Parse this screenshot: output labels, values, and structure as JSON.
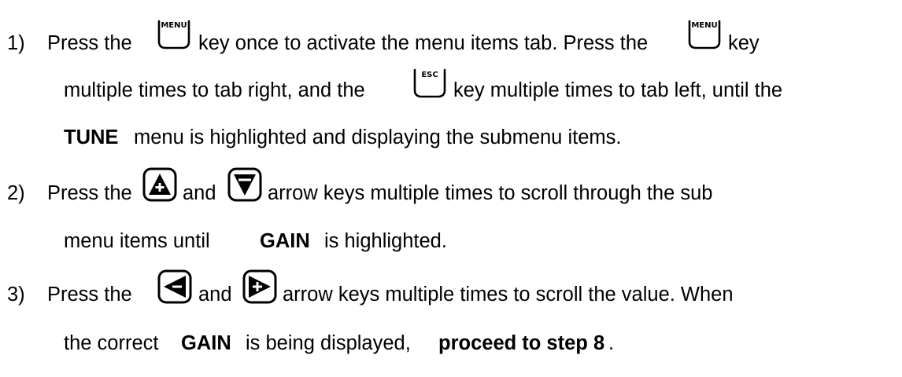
{
  "steps": [
    {
      "number": "1)",
      "line1_part1": "Press the",
      "line1_key1": "MENU",
      "line1_part2": "key once to activate the menu items tab.  Press the",
      "line1_key2": "MENU",
      "line1_part3": "key",
      "line2_part1": "multiple times to tab right, and the",
      "line2_key": "ESC",
      "line2_part2": "key multiple times to tab left, until the",
      "line3_bold": "TUNE",
      "line3_part": "menu is highlighted and displaying the submenu items."
    },
    {
      "number": "2)",
      "line1_part1": "Press the",
      "line1_key1": "up-arrow-key",
      "line1_part2": "and",
      "line1_key2": "down-arrow-key",
      "line1_part3": "arrow keys multiple times to scroll through the sub",
      "line2_part1": "menu items until",
      "line2_bold": "GAIN",
      "line2_part2": "is highlighted."
    },
    {
      "number": "3)",
      "line1_part1": "Press the",
      "line1_key1": "left-arrow-key",
      "line1_part2": "and",
      "line1_key2": "right-arrow-key",
      "line1_part3": "arrow keys multiple times to scroll the value.  When",
      "line2_part1": "the correct",
      "line2_bold1": "GAIN",
      "line2_part2": "is being displayed,",
      "line2_bold2": "proceed to step 8",
      "line2_part3": "."
    }
  ]
}
